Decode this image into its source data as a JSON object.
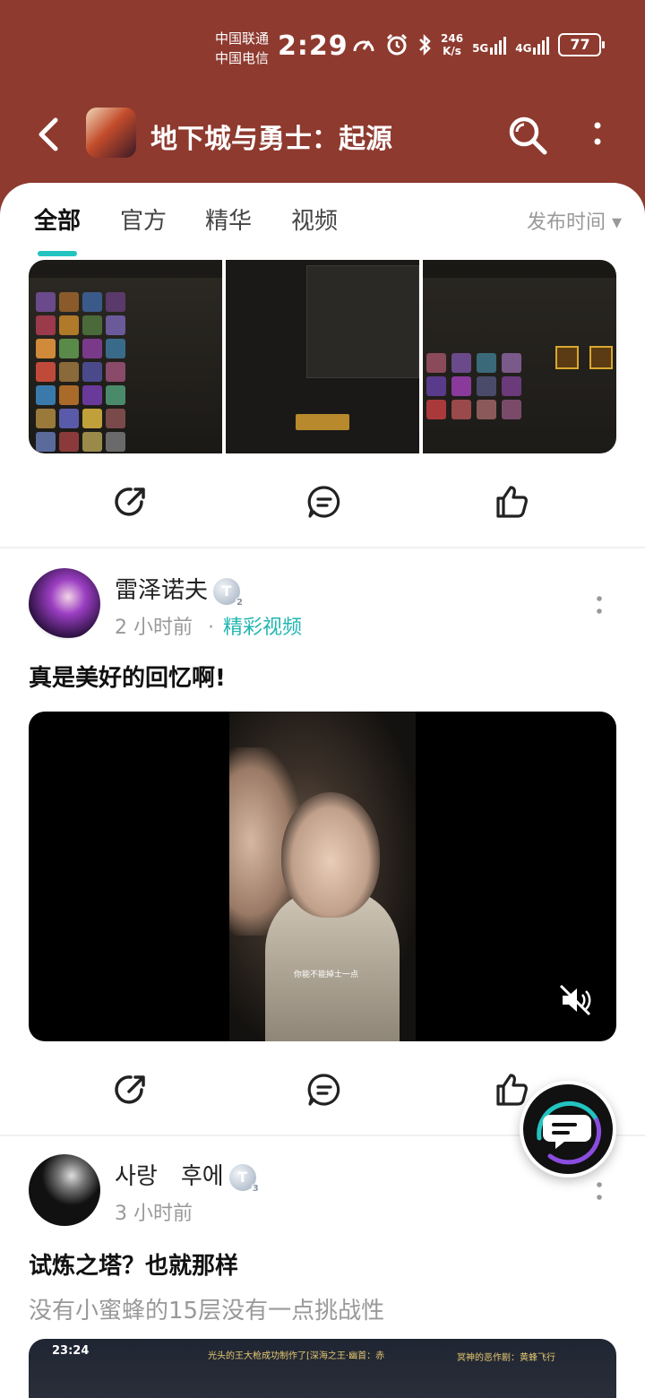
{
  "status_bar": {
    "carrier1": "中国联通",
    "carrier2": "中国电信",
    "time": "2:29",
    "net_speed_value": "246",
    "net_speed_unit": "K/s",
    "signal1_label": "5G",
    "signal2_label": "4G",
    "battery": "77"
  },
  "header": {
    "title": "地下城与勇士：起源"
  },
  "tabs": [
    {
      "label": "全部"
    },
    {
      "label": "官方"
    },
    {
      "label": "精华"
    },
    {
      "label": "视频"
    }
  ],
  "sort": {
    "label": "发布时间 ▾"
  },
  "post1": {
    "username": "雷泽诺夫",
    "badge": "T",
    "badge_level": "2",
    "time": "2 小时前",
    "separator": "·",
    "tag": "精彩视频",
    "title": "真是美好的回忆啊!",
    "video_subtitle": "你能不能掉士一点"
  },
  "post2": {
    "username": "사랑　후에",
    "badge": "T",
    "badge_level": "3",
    "time": "3 小时前",
    "title": "试炼之塔？也就那样",
    "body": "没有小蜜蜂的15层没有一点挑战性",
    "thumb_time": "23:24",
    "thumb_text1": "光头的王大枪成功制作了[深海之王·幽首：赤",
    "thumb_text2": "冥神的恶作剧：黄蜂飞行"
  },
  "colors": {
    "header_bg": "#8e3a2f",
    "accent": "#23c3c0",
    "tag": "#21b6b2"
  }
}
